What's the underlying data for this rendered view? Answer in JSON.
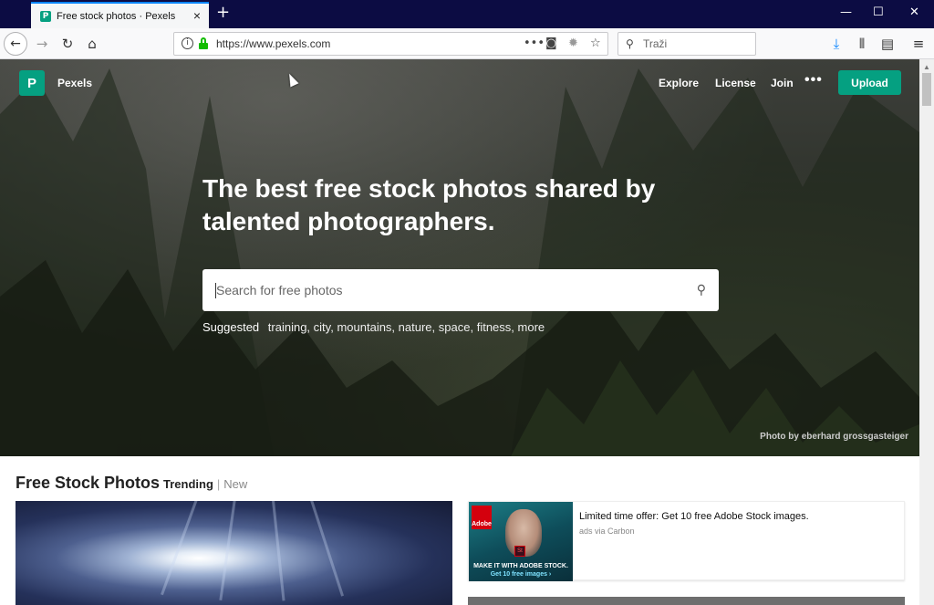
{
  "browser": {
    "tab": {
      "title": "Free stock photos · Pexels",
      "favicon_letter": "P"
    },
    "new_tab_label": "+",
    "window_controls": {
      "minimize": "—",
      "maximize": "☐",
      "close": "✕"
    },
    "url": "https://www.pexels.com",
    "search_placeholder": "Traži",
    "icons": {
      "back": "back-arrow-icon",
      "forward": "forward-arrow-icon",
      "reload": "reload-icon",
      "home": "home-icon",
      "page_actions": "more-dots-icon",
      "pocket": "pocket-icon",
      "tracking": "bug-icon",
      "bookmark": "star-icon",
      "download": "download-icon",
      "library": "library-icon",
      "sidebar": "sidebar-icon",
      "menu": "hamburger-menu-icon"
    }
  },
  "site": {
    "brand": "Pexels",
    "logo_letter": "P",
    "nav": {
      "explore": "Explore",
      "license": "License",
      "join": "Join",
      "more": "•••"
    },
    "upload_label": "Upload",
    "headline": "The best free stock photos shared by talented photographers.",
    "search_placeholder": "Search for free photos",
    "suggested": {
      "label": "Suggested",
      "items": [
        "training,",
        "city,",
        "mountains,",
        "nature,",
        "space,",
        "fitness,",
        "more"
      ]
    },
    "photo_credit": "Photo by eberhard grossgasteiger",
    "section_title": "Free Stock Photos",
    "tabs": {
      "trending": "Trending",
      "separator": "|",
      "new": "New"
    },
    "ad": {
      "title": "Limited time offer: Get 10 free Adobe Stock images.",
      "subtitle": "ads via Carbon",
      "image_caption": "MAKE IT WITH ADOBE STOCK.",
      "image_cta": "Get 10 free images ›",
      "adobe_label": "Adobe",
      "st_label": "St"
    }
  },
  "colors": {
    "brand_green": "#05a081",
    "tab_strip": "#0c0c43",
    "firefox_blue": "#0a84ff",
    "lock_green": "#12bc00"
  }
}
